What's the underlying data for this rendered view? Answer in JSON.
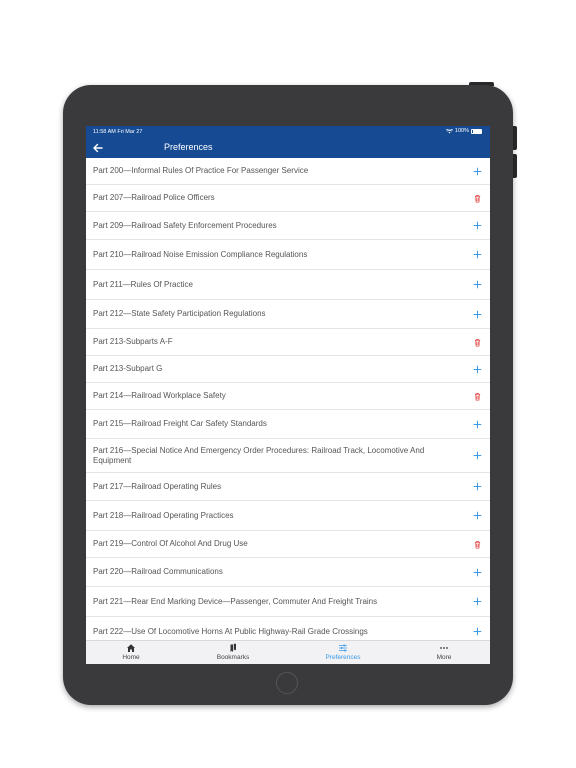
{
  "status": {
    "time": "11:58 AM  Fri Mar 27",
    "battery": "100%"
  },
  "nav": {
    "title": "Preferences",
    "back_icon": "arrow-left-icon"
  },
  "colors": {
    "nav_bg": "#164b94",
    "add": "#3b9ae8",
    "delete": "#e24a4a",
    "active_tab": "#3b9ae8"
  },
  "items": [
    {
      "label": "Part 200—Informal Rules Of Practice For Passenger Service",
      "action": "add"
    },
    {
      "label": "Part 207—Railroad Police Officers",
      "action": "delete"
    },
    {
      "label": "Part 209—Railroad Safety Enforcement Procedures",
      "action": "add"
    },
    {
      "label": "Part 210—Railroad Noise Emission Compliance Regulations",
      "action": "add"
    },
    {
      "label": "Part 211—Rules Of Practice",
      "action": "add"
    },
    {
      "label": "Part 212—State Safety Participation Regulations",
      "action": "add"
    },
    {
      "label": "Part 213-Subparts A-F",
      "action": "delete"
    },
    {
      "label": "Part 213-Subpart G",
      "action": "add"
    },
    {
      "label": "Part 214—Railroad Workplace Safety",
      "action": "delete"
    },
    {
      "label": "Part 215—Railroad Freight Car Safety Standards",
      "action": "add"
    },
    {
      "label": "Part 216—Special Notice And Emergency Order Procedures: Railroad Track, Locomotive And Equipment",
      "action": "add"
    },
    {
      "label": "Part 217—Railroad Operating Rules",
      "action": "add"
    },
    {
      "label": "Part 218—Railroad Operating Practices",
      "action": "add"
    },
    {
      "label": "Part 219—Control Of Alcohol And Drug Use",
      "action": "delete"
    },
    {
      "label": "Part 220—Railroad Communications",
      "action": "add"
    },
    {
      "label": "Part 221—Rear End Marking Device—Passenger, Commuter And Freight Trains",
      "action": "add"
    },
    {
      "label": "Part 222—Use Of Locomotive Horns At Public Highway-Rail Grade Crossings",
      "action": "add"
    }
  ],
  "tabs": [
    {
      "label": "Home",
      "icon": "home-icon",
      "active": false
    },
    {
      "label": "Bookmarks",
      "icon": "bookmarks-icon",
      "active": false
    },
    {
      "label": "Preferences",
      "icon": "sliders-icon",
      "active": true
    },
    {
      "label": "More",
      "icon": "more-icon",
      "active": false
    }
  ]
}
